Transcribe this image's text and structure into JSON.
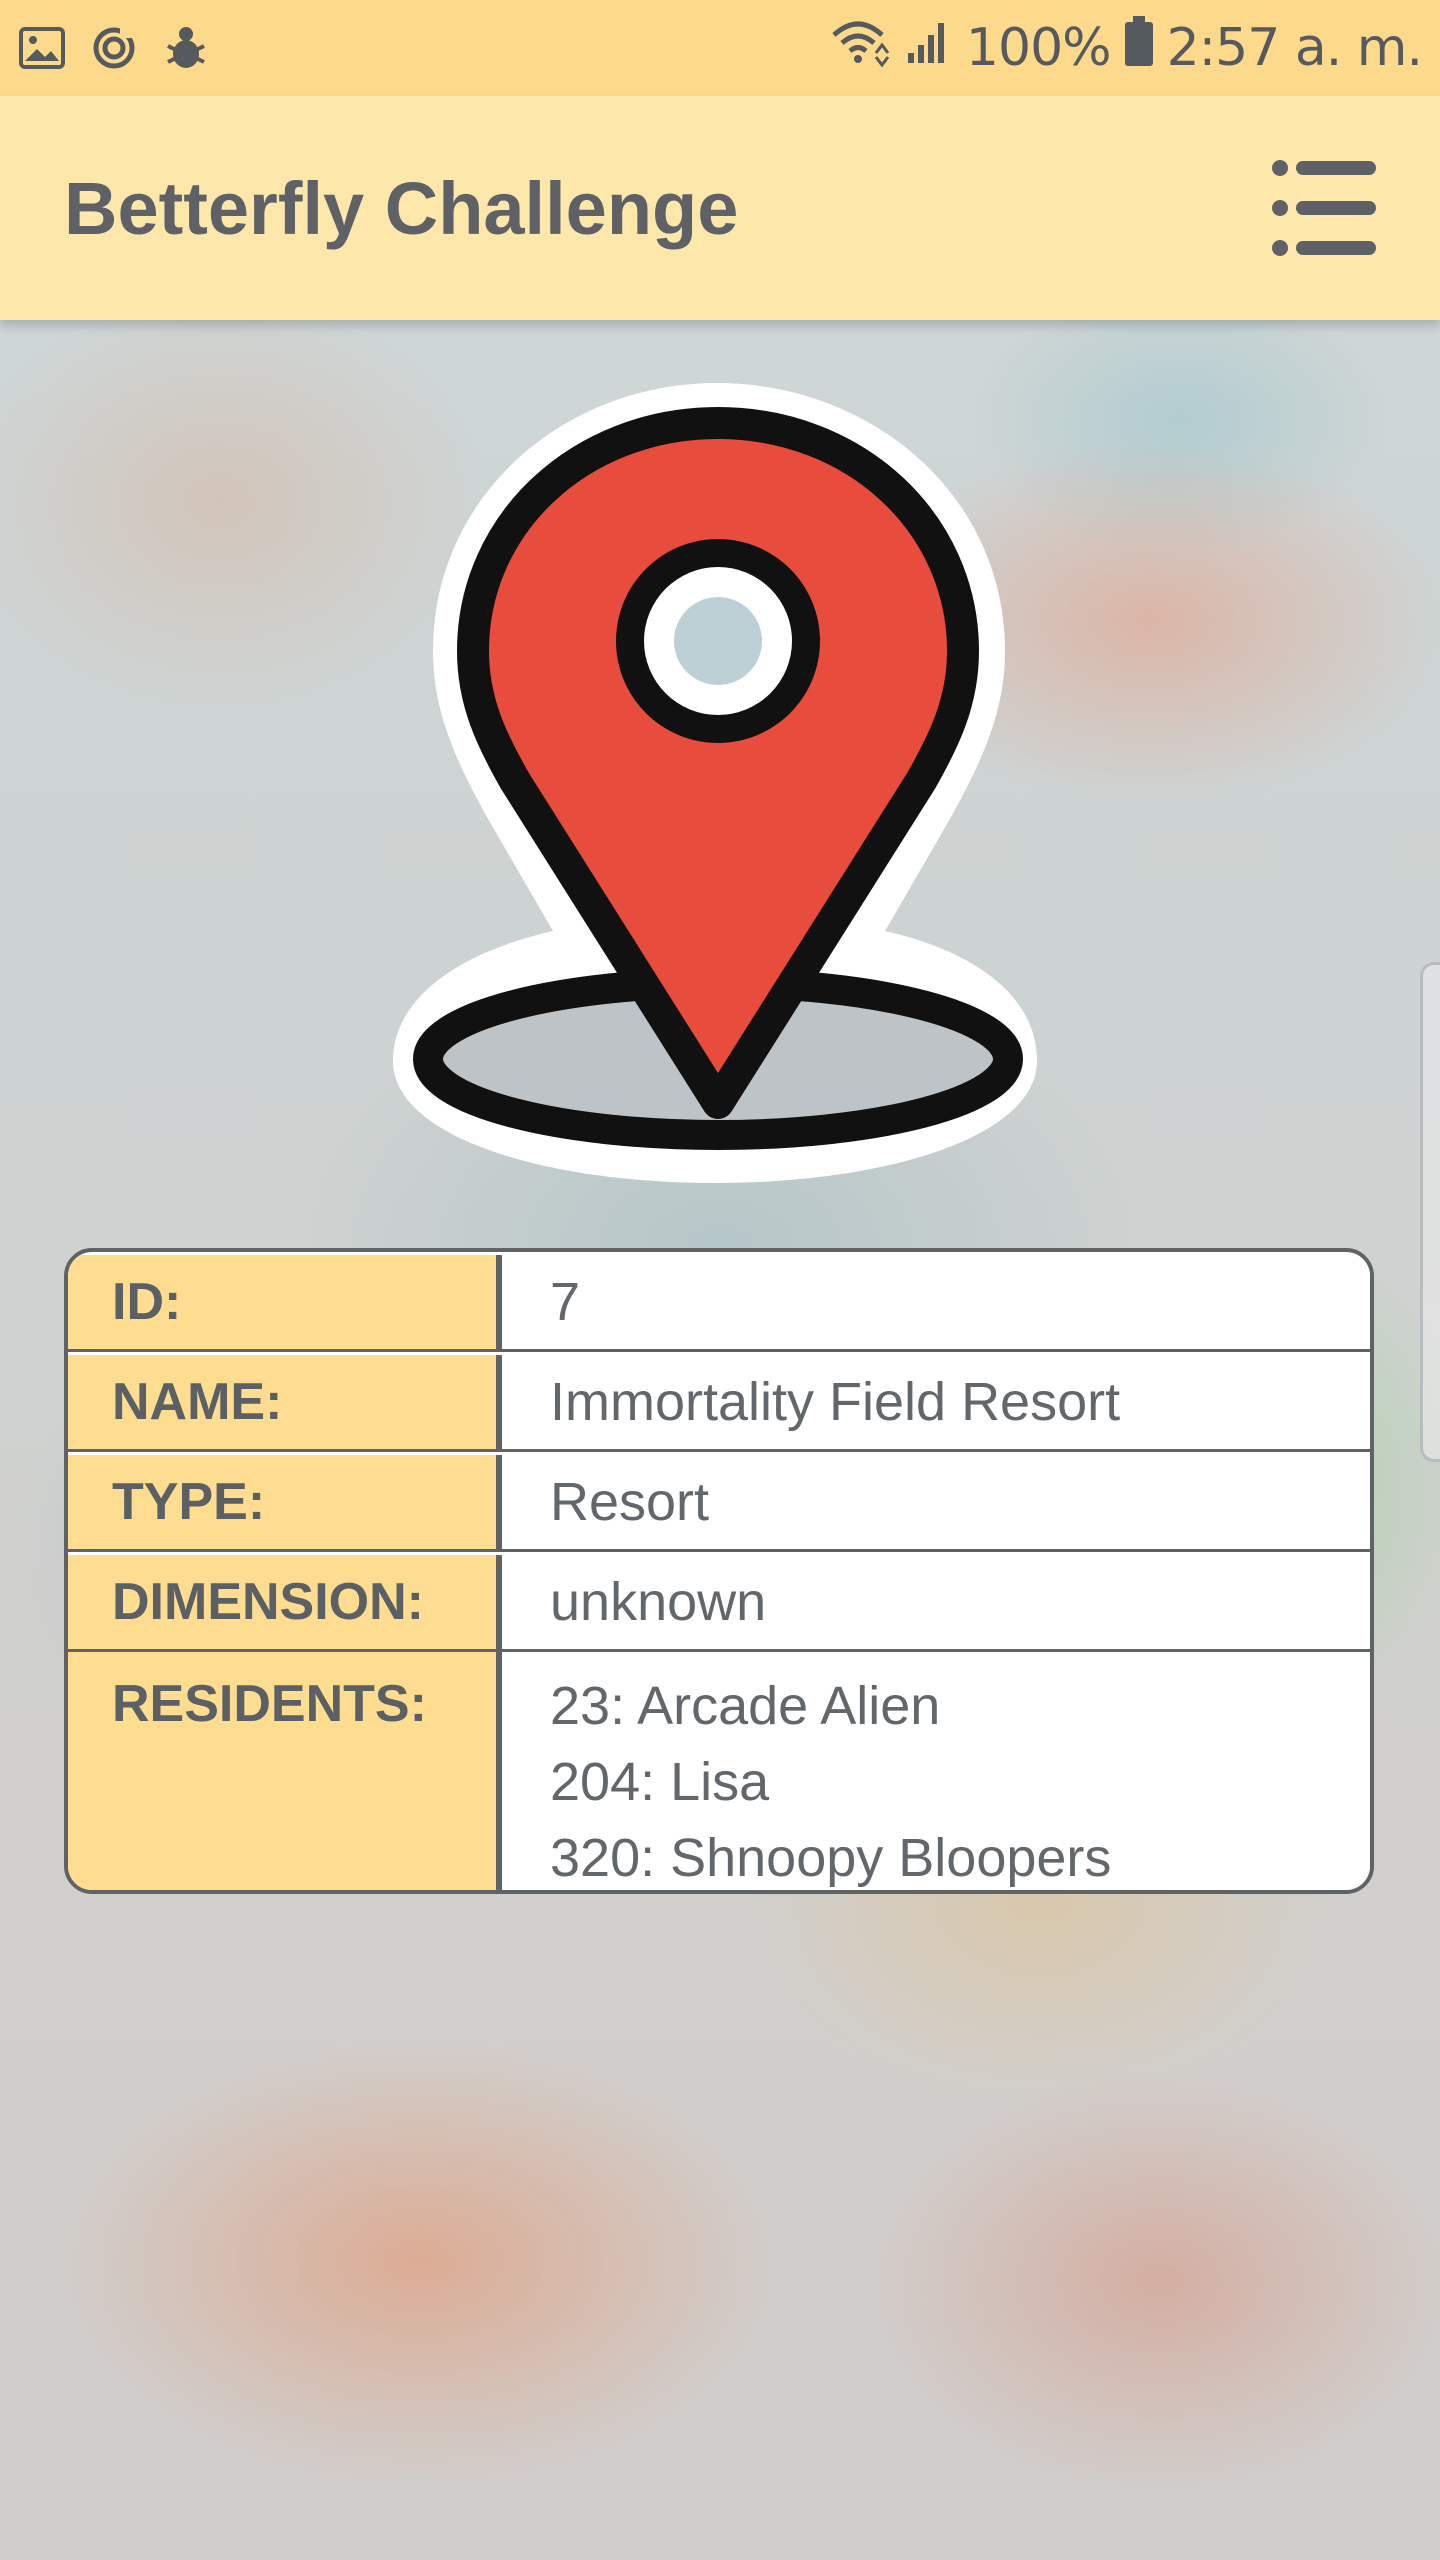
{
  "status_bar": {
    "battery_percent": "100%",
    "time": "2:57 a. m.",
    "icons": [
      "gallery-icon",
      "sync-icon",
      "bug-icon",
      "wifi-icon",
      "signal-icon",
      "battery-icon"
    ]
  },
  "app_bar": {
    "title": "Betterfly Challenge",
    "menu_icon": "menu-icon"
  },
  "pin": {
    "icon": "location-pin-icon",
    "colors": {
      "pin_fill": "#e84c3d",
      "outline": "#111111",
      "base_fill": "#bdc3c7"
    }
  },
  "details": {
    "rows": [
      {
        "label": "ID:",
        "value": "7"
      },
      {
        "label": "NAME:",
        "value": "Immortality Field Resort"
      },
      {
        "label": "TYPE:",
        "value": "Resort"
      },
      {
        "label": "DIMENSION:",
        "value": "unknown"
      }
    ],
    "residents": {
      "label": "RESIDENTS:",
      "items": [
        "23: Arcade Alien",
        "204: Lisa",
        "320: Shnoopy Bloopers"
      ]
    }
  },
  "colors": {
    "status_bar": "#fdd98b",
    "app_bar": "#fde7ab",
    "label_cell": "#fedd90",
    "border": "#5f6366",
    "text": "#5e6266"
  }
}
